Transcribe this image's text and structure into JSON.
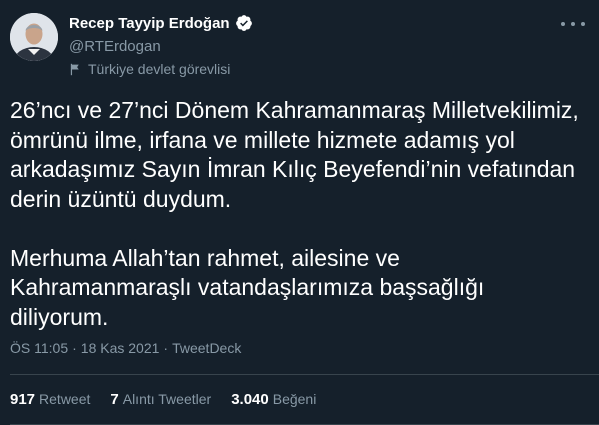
{
  "user": {
    "name": "Recep Tayyip Erdoğan",
    "handle": "@RTErdogan",
    "label": "Türkiye devlet görevlisi"
  },
  "tweet": {
    "paragraph1": "26’ncı ve 27’nci Dönem Kahramanmaraş Milletvekilimiz, ömrünü ilme, irfana ve millete hizmete adamış yol arkadaşımız Sayın İmran Kılıç Beyefendi’nin vefatından derin üzüntü duydum.",
    "paragraph2": "Merhuma Allah’tan rahmet, ailesine ve Kahramanmaraşlı vatandaşlarımıza başsağlığı diliyorum."
  },
  "meta": {
    "time": "ÖS 11:05",
    "sep1": "·",
    "date": "18 Kas 2021",
    "sep2": "·",
    "source": "TweetDeck"
  },
  "stats": {
    "retweets_count": "917",
    "retweets_label": "Retweet",
    "quotes_count": "7",
    "quotes_label": "Alıntı Tweetler",
    "likes_count": "3.040",
    "likes_label": "Beğeni"
  },
  "colors": {
    "background": "#15202b",
    "secondary_text": "#8899a6",
    "divider": "#38444d"
  },
  "icons": {
    "verified": "verified-badge-icon",
    "label": "flag-icon",
    "more": "more-options-icon"
  }
}
